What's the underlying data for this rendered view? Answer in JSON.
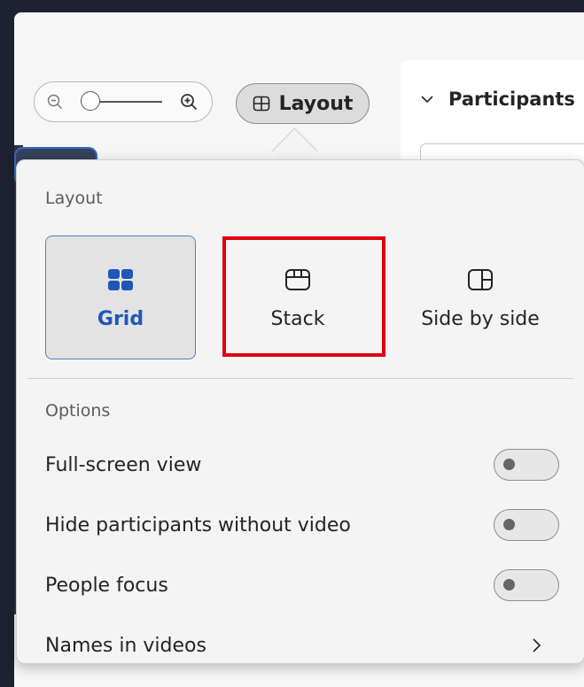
{
  "toolbar": {
    "layout_button_label": "Layout"
  },
  "participants": {
    "header": "Participants"
  },
  "flyout": {
    "layout_section_label": "Layout",
    "layouts": [
      {
        "label": "Grid",
        "icon": "grid-icon",
        "selected": true
      },
      {
        "label": "Stack",
        "icon": "stack-icon",
        "selected": false
      },
      {
        "label": "Side by side",
        "icon": "side-by-side-icon",
        "selected": false
      }
    ],
    "options_section_label": "Options",
    "options": [
      {
        "label": "Full-screen view",
        "type": "toggle",
        "on": false
      },
      {
        "label": "Hide participants without video",
        "type": "toggle",
        "on": false
      },
      {
        "label": "People focus",
        "type": "toggle",
        "on": false
      },
      {
        "label": "Names in videos",
        "type": "submenu"
      }
    ]
  },
  "colors": {
    "accent": "#1f57b8",
    "highlight": "#e0000f"
  }
}
